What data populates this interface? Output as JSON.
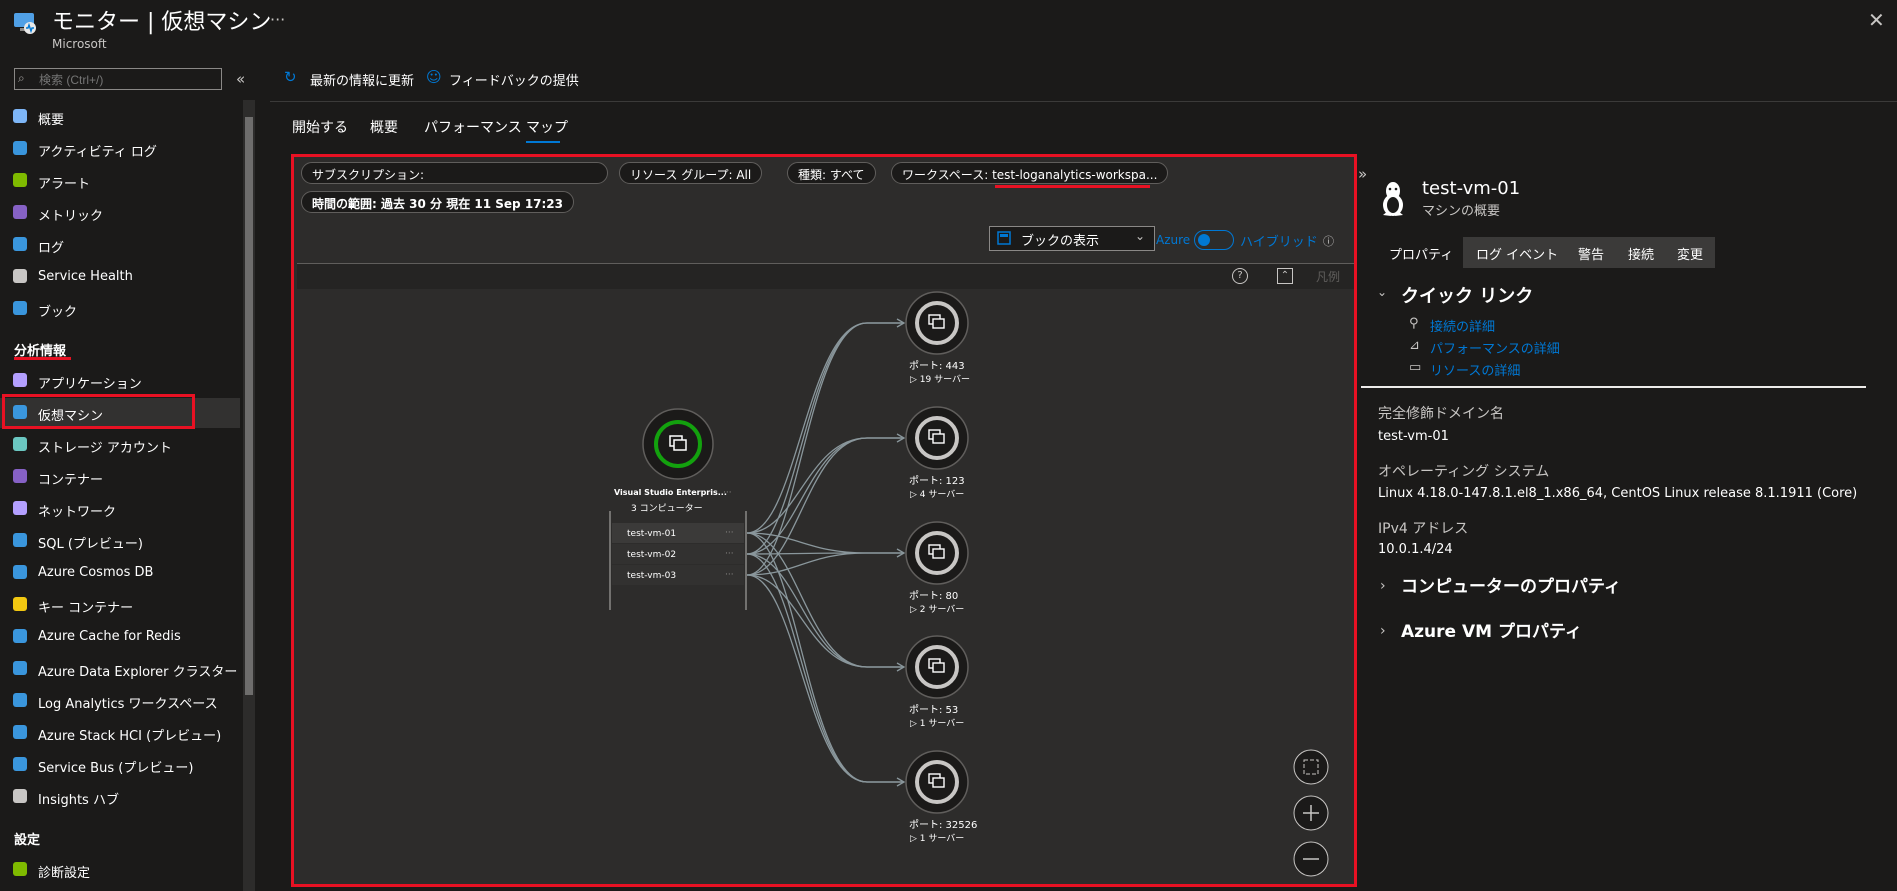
{
  "header": {
    "title": "モニター | 仮想マシン",
    "subtitle": "Microsoft",
    "more": "···",
    "close": "✕"
  },
  "search": {
    "placeholder": "検索 (Ctrl+/)"
  },
  "sidebar": {
    "items_top": [
      {
        "label": "概要",
        "icon": "overview-icon",
        "color": "#7eb6f7"
      },
      {
        "label": "アクティビティ ログ",
        "icon": "activity-log-icon",
        "color": "#3a96dd"
      },
      {
        "label": "アラート",
        "icon": "alert-icon",
        "color": "#7fba00"
      },
      {
        "label": "メトリック",
        "icon": "metrics-icon",
        "color": "#8661c5"
      },
      {
        "label": "ログ",
        "icon": "log-icon",
        "color": "#3a96dd"
      },
      {
        "label": "Service Health",
        "icon": "service-health-icon",
        "color": "#c8c6c4"
      },
      {
        "label": "ブック",
        "icon": "workbook-icon",
        "color": "#3a96dd"
      }
    ],
    "section_insights": "分析情報",
    "items_insights": [
      {
        "label": "アプリケーション",
        "icon": "application-icon",
        "color": "#b4a0ff"
      },
      {
        "label": "仮想マシン",
        "icon": "virtual-machine-icon",
        "color": "#3a96dd"
      },
      {
        "label": "ストレージ アカウント",
        "icon": "storage-icon",
        "color": "#6bc7c1"
      },
      {
        "label": "コンテナー",
        "icon": "container-icon",
        "color": "#8661c5"
      },
      {
        "label": "ネットワーク",
        "icon": "network-icon",
        "color": "#b4a0ff"
      },
      {
        "label": "SQL (プレビュー)",
        "icon": "sql-icon",
        "color": "#3a96dd"
      },
      {
        "label": "Azure Cosmos DB",
        "icon": "cosmos-db-icon",
        "color": "#3a96dd"
      },
      {
        "label": "キー コンテナー",
        "icon": "key-vault-icon",
        "color": "#f2c811"
      },
      {
        "label": "Azure Cache for Redis",
        "icon": "redis-icon",
        "color": "#3a96dd"
      },
      {
        "label": "Azure Data Explorer クラスター",
        "icon": "data-explorer-icon",
        "color": "#3a96dd"
      },
      {
        "label": "Log Analytics ワークスペース",
        "icon": "log-analytics-icon",
        "color": "#3a96dd"
      },
      {
        "label": "Azure Stack HCI (プレビュー)",
        "icon": "stack-hci-icon",
        "color": "#3a96dd"
      },
      {
        "label": "Service Bus (プレビュー)",
        "icon": "service-bus-icon",
        "color": "#3a96dd"
      },
      {
        "label": "Insights ハブ",
        "icon": "more-icon",
        "color": "#c8c6c4"
      }
    ],
    "section_settings": "設定",
    "items_settings": [
      {
        "label": "診断設定",
        "icon": "diagnostic-settings-icon",
        "color": "#7fba00"
      }
    ]
  },
  "toolbar": {
    "refresh_label": "最新の情報に更新",
    "feedback_label": "フィードバックの提供"
  },
  "tabs": [
    "開始する",
    "概要",
    "パフォーマンス",
    "マップ"
  ],
  "filters": {
    "subscription": "サブスクリプション:",
    "resource_group": "リソース グループ: All",
    "kind": "種類: すべて",
    "workspace_prefix": "ワークスペース: ",
    "workspace_value": "test-loganalytics-workspa...",
    "time_range": "時間の範囲: 過去 30 分 現在 11 Sep 17:23"
  },
  "map_toolbar": {
    "workbook_label": "ブックの表示",
    "azure_label": "Azure",
    "hybrid_label": "ハイブリッド",
    "legend_label": "凡例"
  },
  "map": {
    "group_name": "Visual Studio Enterpris...",
    "group_count": "3 コンピューター",
    "vms": [
      "test-vm-01",
      "test-vm-02",
      "test-vm-03"
    ],
    "ports": [
      {
        "label": "ポート: 443",
        "servers": "19 サーバー"
      },
      {
        "label": "ポート: 123",
        "servers": "4 サーバー"
      },
      {
        "label": "ポート: 80",
        "servers": "2 サーバー"
      },
      {
        "label": "ポート: 53",
        "servers": "1 サーバー"
      },
      {
        "label": "ポート: 32526",
        "servers": "1 サーバー"
      }
    ]
  },
  "right_pane": {
    "vm_name": "test-vm-01",
    "vm_sub": "マシンの概要",
    "tabs": [
      "プロパティ",
      "ログ イベント",
      "警告",
      "接続",
      "変更"
    ],
    "quick_links_heading": "クイック リンク",
    "quick_links": [
      "接続の詳細",
      "パフォーマンスの詳細",
      "リソースの詳細"
    ],
    "fqdn_label": "完全修飾ドメイン名",
    "fqdn_value": "test-vm-01",
    "os_label": "オペレーティング システム",
    "os_value": "Linux 4.18.0-147.8.1.el8_1.x86_64, CentOS Linux release 8.1.1911 (Core)",
    "ipv4_label": "IPv4 アドレス",
    "ipv4_value": "10.0.1.4/24",
    "computer_props": "コンピューターのプロパティ",
    "azure_vm_props": "Azure VM プロパティ"
  },
  "colors": {
    "accent": "#0078d4",
    "highlight": "#e81123",
    "node_ok": "#13a10e"
  }
}
